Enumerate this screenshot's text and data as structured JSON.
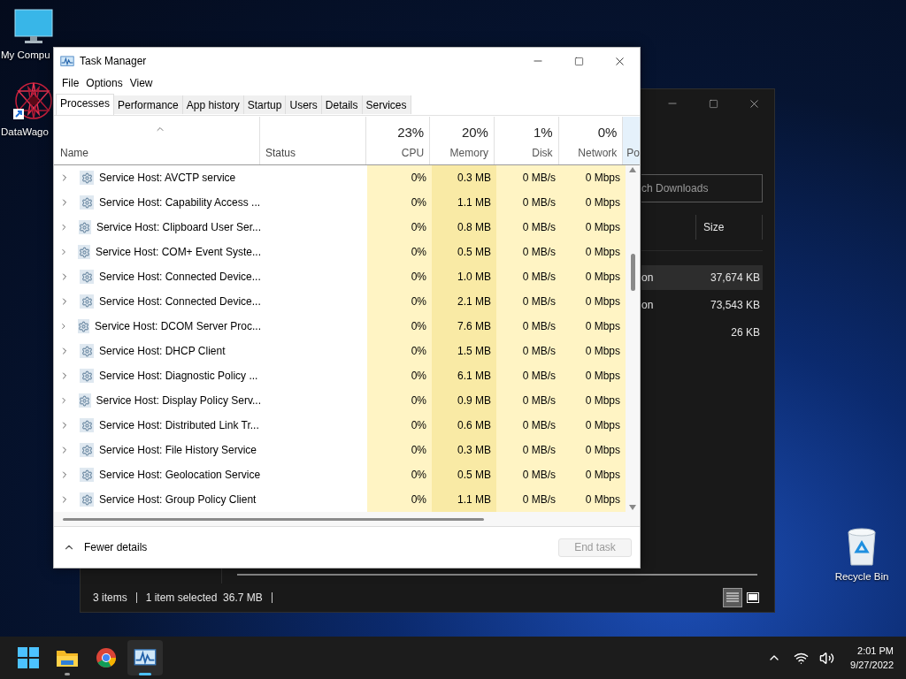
{
  "desktop_icons": [
    {
      "kind": "computer",
      "label": "My Compu"
    },
    {
      "kind": "app",
      "label": "DataWago"
    },
    {
      "kind": "recycle",
      "label": "Recycle Bin"
    }
  ],
  "explorer": {
    "search": {
      "placeholder": "ch Downloads"
    },
    "columns": [
      "Size"
    ],
    "rows": [
      {
        "name": "on",
        "size": "37,674 KB",
        "selected": true
      },
      {
        "name": "on",
        "size": "73,543 KB",
        "selected": false
      },
      {
        "name": "",
        "size": "26 KB",
        "selected": false
      }
    ],
    "status_bar": [
      "3 items",
      "1 item selected  36.7 MB"
    ]
  },
  "task_manager": {
    "window": {
      "title": "Task Manager"
    },
    "menu": [
      "File",
      "Options",
      "View"
    ],
    "tabs": [
      {
        "label": "Processes",
        "selected": true
      },
      {
        "label": "Performance",
        "selected": false
      },
      {
        "label": "App history",
        "selected": false
      },
      {
        "label": "Startup",
        "selected": false
      },
      {
        "label": "Users",
        "selected": false
      },
      {
        "label": "Details",
        "selected": false
      },
      {
        "label": "Services",
        "selected": false
      }
    ],
    "columns": [
      {
        "label": "Name"
      },
      {
        "label": "Status"
      },
      {
        "usage": "23%",
        "label": "CPU"
      },
      {
        "usage": "20%",
        "label": "Memory"
      },
      {
        "usage": "1%",
        "label": "Disk"
      },
      {
        "usage": "0%",
        "label": "Network"
      },
      {
        "label": "Po"
      }
    ],
    "rows": [
      {
        "name": "Service Host: AVCTP service",
        "cpu": "0%",
        "memory": "0.3 MB",
        "disk": "0 MB/s",
        "network": "0 Mbps"
      },
      {
        "name": "Service Host: Capability Access ...",
        "cpu": "0%",
        "memory": "1.1 MB",
        "disk": "0 MB/s",
        "network": "0 Mbps"
      },
      {
        "name": "Service Host: Clipboard User Ser...",
        "cpu": "0%",
        "memory": "0.8 MB",
        "disk": "0 MB/s",
        "network": "0 Mbps"
      },
      {
        "name": "Service Host: COM+ Event Syste...",
        "cpu": "0%",
        "memory": "0.5 MB",
        "disk": "0 MB/s",
        "network": "0 Mbps"
      },
      {
        "name": "Service Host: Connected Device...",
        "cpu": "0%",
        "memory": "1.0 MB",
        "disk": "0 MB/s",
        "network": "0 Mbps"
      },
      {
        "name": "Service Host: Connected Device...",
        "cpu": "0%",
        "memory": "2.1 MB",
        "disk": "0 MB/s",
        "network": "0 Mbps"
      },
      {
        "name": "Service Host: DCOM Server Proc...",
        "cpu": "0%",
        "memory": "7.6 MB",
        "disk": "0 MB/s",
        "network": "0 Mbps"
      },
      {
        "name": "Service Host: DHCP Client",
        "cpu": "0%",
        "memory": "1.5 MB",
        "disk": "0 MB/s",
        "network": "0 Mbps"
      },
      {
        "name": "Service Host: Diagnostic Policy ...",
        "cpu": "0%",
        "memory": "6.1 MB",
        "disk": "0 MB/s",
        "network": "0 Mbps"
      },
      {
        "name": "Service Host: Display Policy Serv...",
        "cpu": "0%",
        "memory": "0.9 MB",
        "disk": "0 MB/s",
        "network": "0 Mbps"
      },
      {
        "name": "Service Host: Distributed Link Tr...",
        "cpu": "0%",
        "memory": "0.6 MB",
        "disk": "0 MB/s",
        "network": "0 Mbps"
      },
      {
        "name": "Service Host: File History Service",
        "cpu": "0%",
        "memory": "0.3 MB",
        "disk": "0 MB/s",
        "network": "0 Mbps"
      },
      {
        "name": "Service Host: Geolocation Service",
        "cpu": "0%",
        "memory": "0.5 MB",
        "disk": "0 MB/s",
        "network": "0 Mbps"
      },
      {
        "name": "Service Host: Group Policy Client",
        "cpu": "0%",
        "memory": "1.1 MB",
        "disk": "0 MB/s",
        "network": "0 Mbps"
      }
    ],
    "footer": {
      "toggle": "Fewer details",
      "button": {
        "label": "End task",
        "disabled": true
      }
    }
  },
  "taskbar": {
    "apps": [
      {
        "kind": "start",
        "active": false
      },
      {
        "kind": "files",
        "active": false,
        "running": true
      },
      {
        "kind": "browser",
        "active": false,
        "running": false
      },
      {
        "kind": "taskmanager",
        "active": true,
        "running": true
      }
    ],
    "time": "2:01 PM",
    "date": "9/27/2022"
  }
}
